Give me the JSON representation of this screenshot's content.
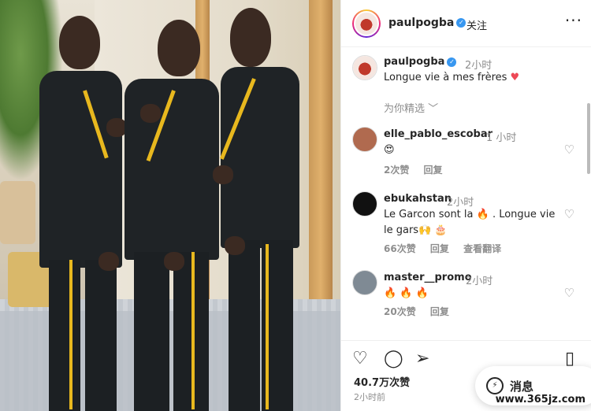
{
  "header": {
    "username": "paulpogba",
    "verified_icon": "verified-badge-icon",
    "follow": "关注",
    "more": "···"
  },
  "caption": {
    "username": "paulpogba",
    "time": "2小时",
    "text": "Longue vie à mes frères",
    "emoji": "♥",
    "translate": "为你精选 ﹀"
  },
  "comments": [
    {
      "username": "elle_pablo_escobar",
      "time": "1 小时",
      "text": "😍",
      "likes": "2次赞",
      "reply": "回复",
      "translate": ""
    },
    {
      "username": "ebukahstan",
      "time": "2小时",
      "text": "Le Garcon sont la 🔥 . Longue vie le gars🙌 🎂",
      "likes": "66次赞",
      "reply": "回复",
      "translate": "查看翻译"
    },
    {
      "username": "master__promo",
      "time": "2小时",
      "text": "🔥 🔥 🔥",
      "likes": "20次赞",
      "reply": "回复",
      "translate": ""
    }
  ],
  "actions": {
    "likes": "40.7万次赞",
    "time": "2小时前",
    "message": "消息",
    "watermark": "www.365jz.com"
  },
  "colors": {
    "accent": "#3897f0",
    "heart": "#ed4956",
    "gold": "#e8b81e"
  }
}
